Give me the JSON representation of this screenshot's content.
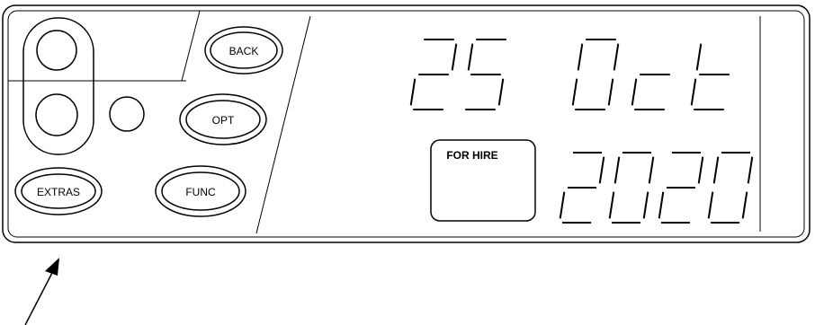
{
  "buttons": {
    "back": "BACK",
    "opt": "OPT",
    "extras": "EXTRAS",
    "func": "FUNC"
  },
  "indicator": {
    "label": "FOR HIRE"
  },
  "display": {
    "day": "25",
    "month": "Oct",
    "year": "2020"
  }
}
